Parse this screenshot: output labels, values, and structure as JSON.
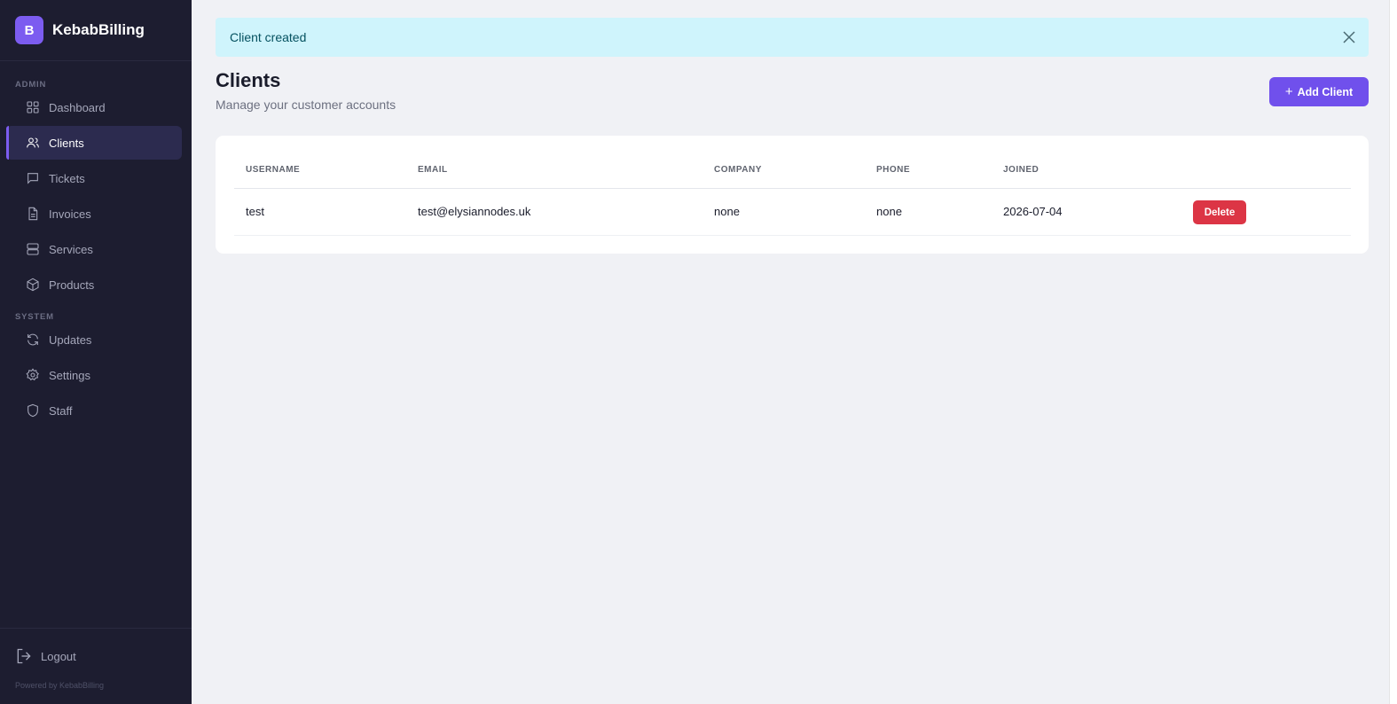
{
  "brand": {
    "logo_letter": "B",
    "name": "KebabBilling"
  },
  "sidebar": {
    "sections": [
      {
        "label": "ADMIN"
      },
      {
        "label": "SYSTEM"
      }
    ],
    "items": [
      {
        "label": "Dashboard",
        "icon": "grid-icon"
      },
      {
        "label": "Clients",
        "icon": "users-icon",
        "active": true
      },
      {
        "label": "Tickets",
        "icon": "message-square-icon"
      },
      {
        "label": "Invoices",
        "icon": "file-text-icon"
      },
      {
        "label": "Services",
        "icon": "server-icon"
      },
      {
        "label": "Products",
        "icon": "package-icon"
      },
      {
        "label": "Updates",
        "icon": "refresh-icon"
      },
      {
        "label": "Settings",
        "icon": "gear-icon"
      },
      {
        "label": "Staff",
        "icon": "shield-icon"
      }
    ],
    "logout_label": "Logout",
    "powered_by": "Powered by KebabBilling"
  },
  "alert": {
    "message": "Client created"
  },
  "page": {
    "title": "Clients",
    "subtitle": "Manage your customer accounts",
    "add_button_label": "Add Client"
  },
  "table": {
    "columns": [
      "USERNAME",
      "EMAIL",
      "COMPANY",
      "PHONE",
      "JOINED"
    ],
    "rows": [
      {
        "username": "test",
        "email": "test@elysiannodes.uk",
        "company": "none",
        "phone": "none",
        "joined": "2026-07-04",
        "delete_label": "Delete"
      }
    ]
  },
  "colors": {
    "sidebar_bg": "#1d1d30",
    "accent": "#7050ec",
    "alert_bg": "#cff4fc",
    "danger": "#dc3545"
  }
}
